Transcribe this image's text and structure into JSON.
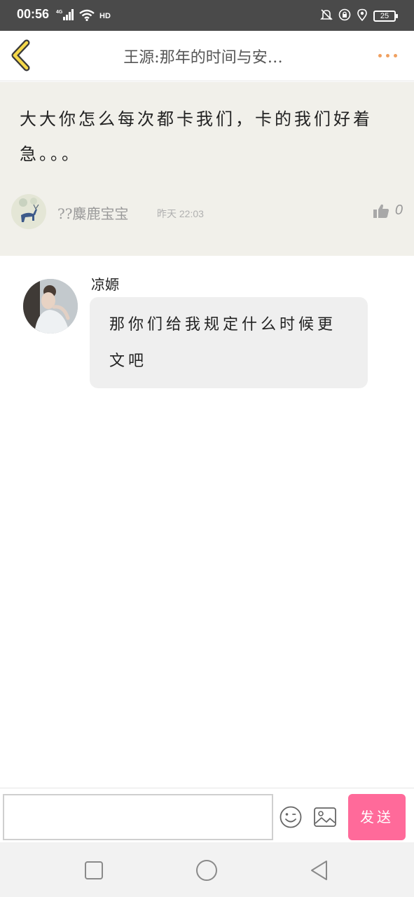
{
  "status_bar": {
    "time": "00:56",
    "network_label": "4G",
    "hd_label": "HD",
    "battery": "25",
    "icons": [
      "signal-icon",
      "wifi-icon",
      "silent-icon",
      "lock-rotation-icon",
      "location-icon",
      "battery-icon"
    ]
  },
  "header": {
    "title": "王源:那年的时间与安…",
    "back_icon": "chevron-left-icon",
    "more_icon": "more-dots-icon",
    "accent_color": "#f5c400"
  },
  "original_comment": {
    "text": "大大你怎么每次都卡我们，卡的我们好着急。。。",
    "author": "??麋鹿宝宝",
    "time": "昨天 22:03",
    "like_count": "0",
    "like_icon": "thumbs-up-icon"
  },
  "reply": {
    "author": "凉嫄",
    "text": "那你们给我规定什么时候更文吧"
  },
  "input_bar": {
    "placeholder": "",
    "emoji_icon": "emoji-icon",
    "image_icon": "image-icon",
    "send_label": "发送",
    "send_color": "#ff6a9a"
  },
  "nav_bar": {
    "icons": [
      "recent-apps-icon",
      "home-icon",
      "back-icon"
    ]
  }
}
